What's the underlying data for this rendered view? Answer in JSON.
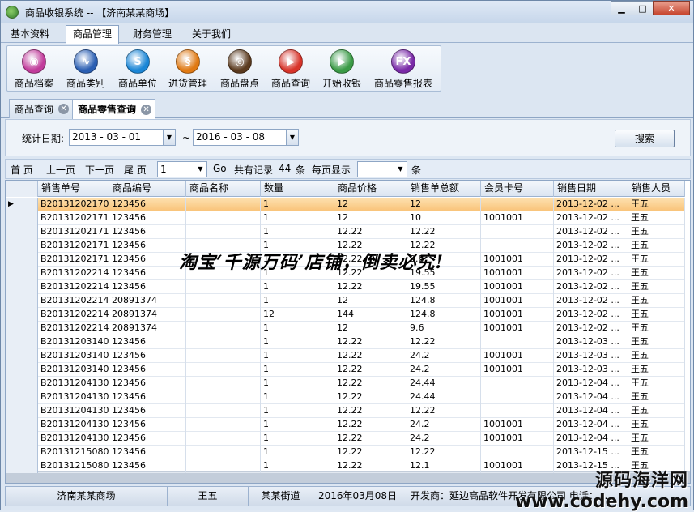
{
  "window": {
    "title": "商品收银系统 -- 【济南某某商场】",
    "min": "▁",
    "max": "□",
    "close": "✕"
  },
  "menu": [
    "基本资料",
    "商品管理",
    "财务管理",
    "关于我们"
  ],
  "ribbon": [
    {
      "label": "商品档案",
      "icon": "product-archive-icon",
      "color": "#c13c9b",
      "glyph": "◉"
    },
    {
      "label": "商品类别",
      "icon": "category-wave-icon",
      "color": "#2b5fb3",
      "glyph": "∿"
    },
    {
      "label": "商品单位",
      "icon": "unit-s-icon",
      "color": "#1b86d6",
      "glyph": "S"
    },
    {
      "label": "进货管理",
      "icon": "purchase-icon",
      "color": "#e07a14",
      "glyph": "§"
    },
    {
      "label": "商品盘点",
      "icon": "inventory-camera-icon",
      "color": "#5b3a1e",
      "glyph": "◎"
    },
    {
      "label": "商品查询",
      "icon": "query-play-icon",
      "color": "#d8342a",
      "glyph": "▶"
    },
    {
      "label": "开始收银",
      "icon": "checkout-play-icon",
      "color": "#3b9b46",
      "glyph": "▶"
    },
    {
      "label": "商品零售报表",
      "icon": "report-fx-icon",
      "color": "#7a2aa8",
      "glyph": "FX"
    }
  ],
  "tabs": [
    {
      "label": "商品查询",
      "close": "✕"
    },
    {
      "label": "商品零售查询",
      "close": "✕"
    }
  ],
  "filter": {
    "label": "统计日期:",
    "start": "2013 - 03 - 01",
    "sep": "~",
    "end": "2016 - 03 - 08",
    "search": "搜索"
  },
  "pager": {
    "first": "首 页",
    "prev": "上一页",
    "next": "下一页",
    "last": "尾 页",
    "page": "1",
    "go": "Go",
    "total_prefix": "共有记录",
    "total": "44",
    "total_suffix": "条",
    "per_page": "每页显示",
    "per_page_value": "",
    "per_suffix": "条"
  },
  "table": {
    "columns": [
      "销售单号",
      "商品编号",
      "商品名称",
      "数量",
      "商品价格",
      "销售单总额",
      "会员卡号",
      "销售日期",
      "销售人员"
    ],
    "rows": [
      [
        "B20131202170...",
        "123456",
        "",
        "1",
        "12",
        "12",
        "",
        "2013-12-02 ...",
        "王五"
      ],
      [
        "B20131202171...",
        "123456",
        "",
        "1",
        "12",
        "10",
        "1001001",
        "2013-12-02 ...",
        "王五"
      ],
      [
        "B20131202171...",
        "123456",
        "",
        "1",
        "12.22",
        "12.22",
        "",
        "2013-12-02 ...",
        "王五"
      ],
      [
        "B20131202171...",
        "123456",
        "",
        "1",
        "12.22",
        "12.22",
        "",
        "2013-12-02 ...",
        "王五"
      ],
      [
        "B20131202171...",
        "123456",
        "",
        "1",
        "12.22",
        "9.8",
        "1001001",
        "2013-12-02 ...",
        "王五"
      ],
      [
        "B20131202214...",
        "123456",
        "",
        "1",
        "12.22",
        "19.55",
        "1001001",
        "2013-12-02 ...",
        "王五"
      ],
      [
        "B20131202214...",
        "123456",
        "",
        "1",
        "12.22",
        "19.55",
        "1001001",
        "2013-12-02 ...",
        "王五"
      ],
      [
        "B20131202214...",
        "20891374",
        "",
        "1",
        "12",
        "124.8",
        "1001001",
        "2013-12-02 ...",
        "王五"
      ],
      [
        "B20131202214...",
        "20891374",
        "",
        "12",
        "144",
        "124.8",
        "1001001",
        "2013-12-02 ...",
        "王五"
      ],
      [
        "B20131202214...",
        "20891374",
        "",
        "1",
        "12",
        "9.6",
        "1001001",
        "2013-12-02 ...",
        "王五"
      ],
      [
        "B20131203140...",
        "123456",
        "",
        "1",
        "12.22",
        "12.22",
        "",
        "2013-12-03 ...",
        "王五"
      ],
      [
        "B20131203140...",
        "123456",
        "",
        "1",
        "12.22",
        "24.2",
        "1001001",
        "2013-12-03 ...",
        "王五"
      ],
      [
        "B20131203140...",
        "123456",
        "",
        "1",
        "12.22",
        "24.2",
        "1001001",
        "2013-12-03 ...",
        "王五"
      ],
      [
        "B20131204130...",
        "123456",
        "",
        "1",
        "12.22",
        "24.44",
        "",
        "2013-12-04 ...",
        "王五"
      ],
      [
        "B20131204130...",
        "123456",
        "",
        "1",
        "12.22",
        "24.44",
        "",
        "2013-12-04 ...",
        "王五"
      ],
      [
        "B20131204130...",
        "123456",
        "",
        "1",
        "12.22",
        "12.22",
        "",
        "2013-12-04 ...",
        "王五"
      ],
      [
        "B20131204130...",
        "123456",
        "",
        "1",
        "12.22",
        "24.2",
        "1001001",
        "2013-12-04 ...",
        "王五"
      ],
      [
        "B20131204130...",
        "123456",
        "",
        "1",
        "12.22",
        "24.2",
        "1001001",
        "2013-12-04 ...",
        "王五"
      ],
      [
        "B20131215080...",
        "123456",
        "",
        "1",
        "12.22",
        "12.22",
        "",
        "2013-12-15 ...",
        "王五"
      ],
      [
        "B20131215080...",
        "123456",
        "",
        "1",
        "12.22",
        "12.1",
        "1001001",
        "2013-12-15 ...",
        "王五"
      ]
    ]
  },
  "watermark": "淘宝‘千源万码’店铺，倒卖必究!",
  "status": [
    "济南某某商场",
    "王五",
    "某某街道",
    "2016年03月08日",
    "开发商：延边高品软件开发有限公司 电话：..."
  ],
  "site": {
    "name": "源码海洋网",
    "url": "www.codehy.com"
  }
}
